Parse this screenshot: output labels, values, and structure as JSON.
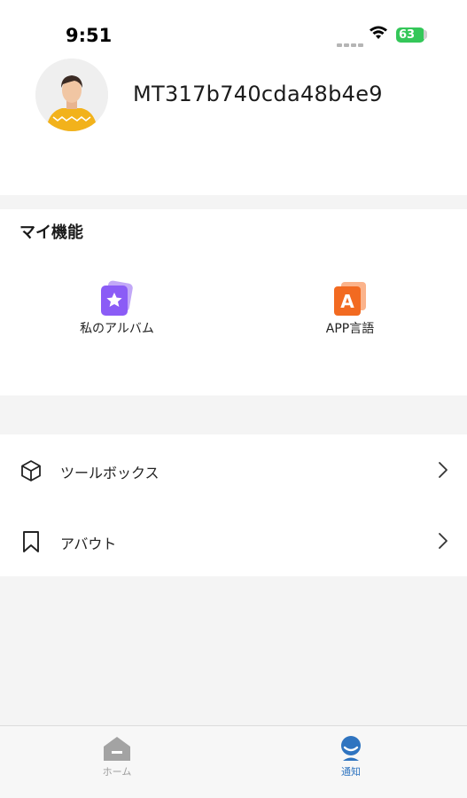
{
  "status_bar": {
    "time": "9:51",
    "battery": "63"
  },
  "profile": {
    "username": "MT317b740cda48b4e9"
  },
  "features": {
    "title": "マイ機能",
    "items": [
      {
        "label": "私のアルバム",
        "icon": "album-star-icon"
      },
      {
        "label": "APP言語",
        "icon": "language-a-icon"
      }
    ]
  },
  "menu": {
    "items": [
      {
        "label": "ツールボックス",
        "icon": "cube-icon"
      },
      {
        "label": "アバウト",
        "icon": "bookmark-icon"
      }
    ]
  },
  "tabbar": {
    "tabs": [
      {
        "label": "ホーム",
        "icon": "home-icon",
        "active": false
      },
      {
        "label": "通知",
        "icon": "profile-icon",
        "active": true
      }
    ]
  },
  "colors": {
    "accent": "#2f74c0",
    "album": "#8b5cf6",
    "language": "#f26a21",
    "battery": "#34c759",
    "tab_inactive": "#9e9e9e"
  }
}
